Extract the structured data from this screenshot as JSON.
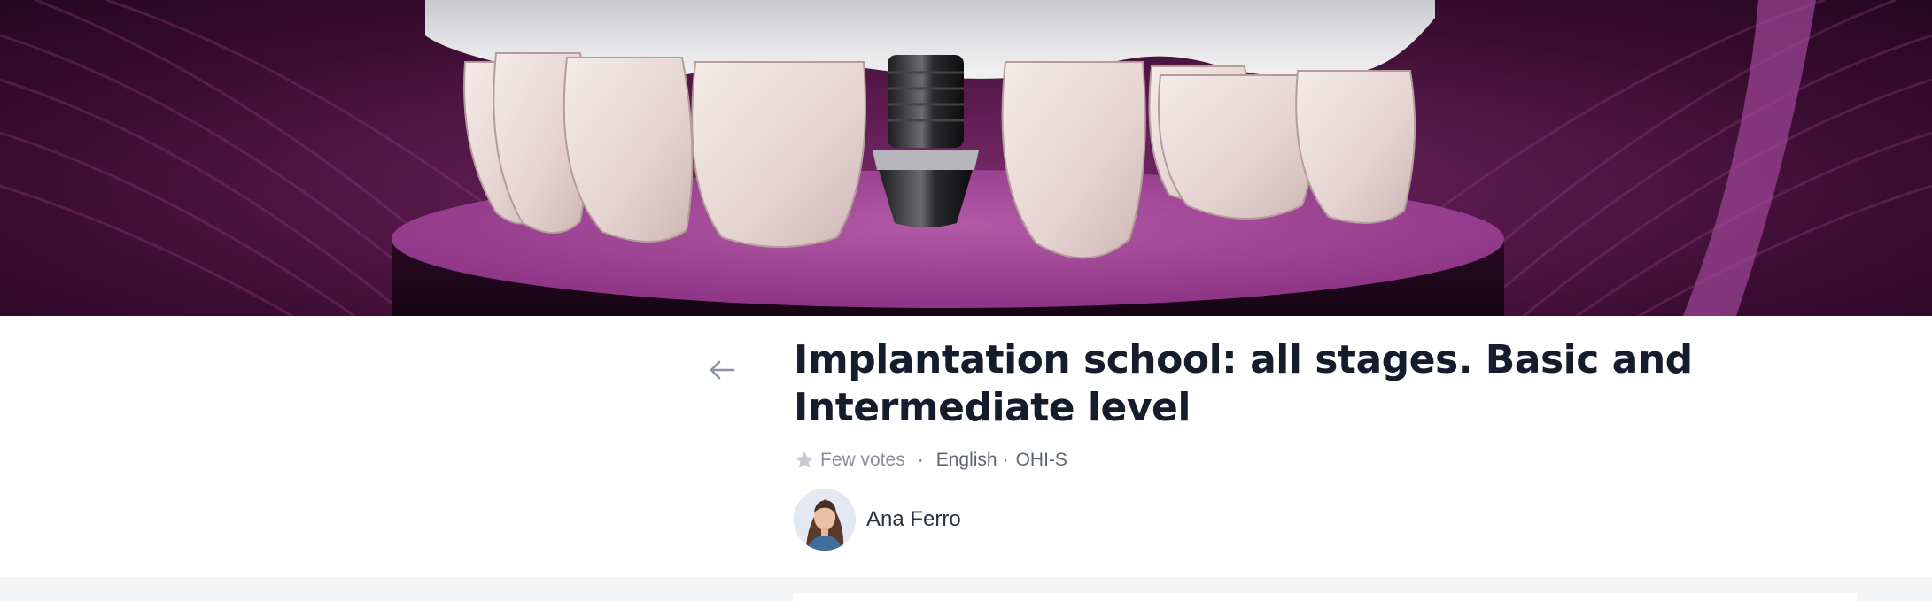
{
  "course": {
    "title": "Implantation school: all stages. Basic and Intermediate level",
    "rating_label": "Few votes",
    "language": "English",
    "provider": "OHI-S",
    "author_name": "Ana Ferro"
  },
  "icons": {
    "back": "arrow-left-icon",
    "rating": "star-icon"
  },
  "colors": {
    "banner_purple": "#5a1a4e",
    "title_text": "#151d2c",
    "muted_text": "#8a909b",
    "star_gray": "#c5c9d0"
  }
}
